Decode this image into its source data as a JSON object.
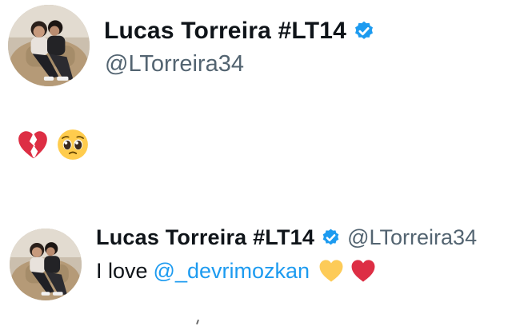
{
  "tweet_top": {
    "display_name": "Lucas Torreira #LT14",
    "handle": "@LTorreira34",
    "verified": true,
    "body_emojis": [
      "broken-heart",
      "pleading-face"
    ]
  },
  "tweet_bottom": {
    "display_name": "Lucas Torreira #LT14",
    "handle": "@LTorreira34",
    "verified": true,
    "text": "I love",
    "mention": "@_devrimozkan",
    "body_emojis": [
      "yellow-heart",
      "red-heart"
    ]
  },
  "colors": {
    "text": "#0f1419",
    "secondary_text": "#536471",
    "link": "#1d9bf0",
    "verified_badge": "#1d9bf0",
    "background": "#ffffff"
  }
}
